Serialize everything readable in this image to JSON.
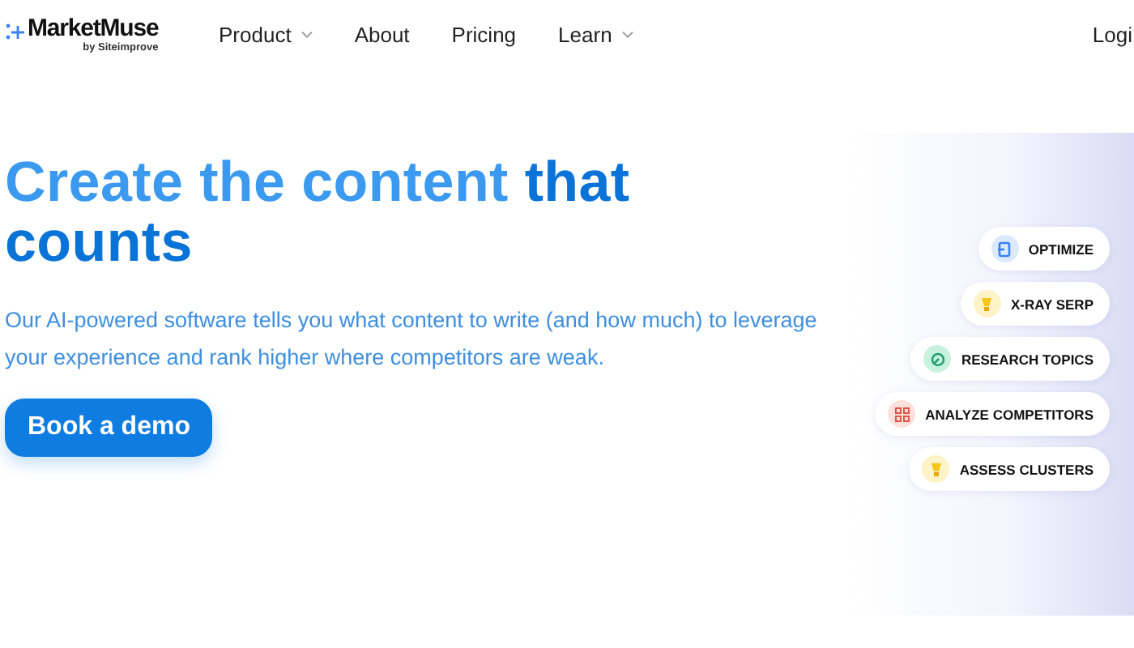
{
  "header": {
    "logo": {
      "name": "MarketMuse",
      "tagline": "by Siteimprove"
    },
    "nav": [
      {
        "label": "Product",
        "dropdown": true
      },
      {
        "label": "About",
        "dropdown": false
      },
      {
        "label": "Pricing",
        "dropdown": false
      },
      {
        "label": "Learn",
        "dropdown": true
      }
    ],
    "login": "Logi"
  },
  "hero": {
    "headline": "Create the content **that counts**",
    "description": "Our AI-powered software tells you what content to write (and how much) to leverage your experience and rank higher where competitors are weak.",
    "cta": "Book a demo"
  },
  "features": [
    {
      "label": "OPTIMIZE",
      "kind": "optimize",
      "color": "#dbeafe"
    },
    {
      "label": "X-RAY SERP",
      "kind": "bulb",
      "color": "#fef3c7"
    },
    {
      "label": "RESEARCH TOPICS",
      "kind": "research",
      "color": "#c9f2de"
    },
    {
      "label": "ANALYZE COMPETITORS",
      "kind": "grid",
      "color": "#fde0dc"
    },
    {
      "label": "ASSESS CLUSTERS",
      "kind": "bulb",
      "color": "#fef3c7"
    }
  ]
}
